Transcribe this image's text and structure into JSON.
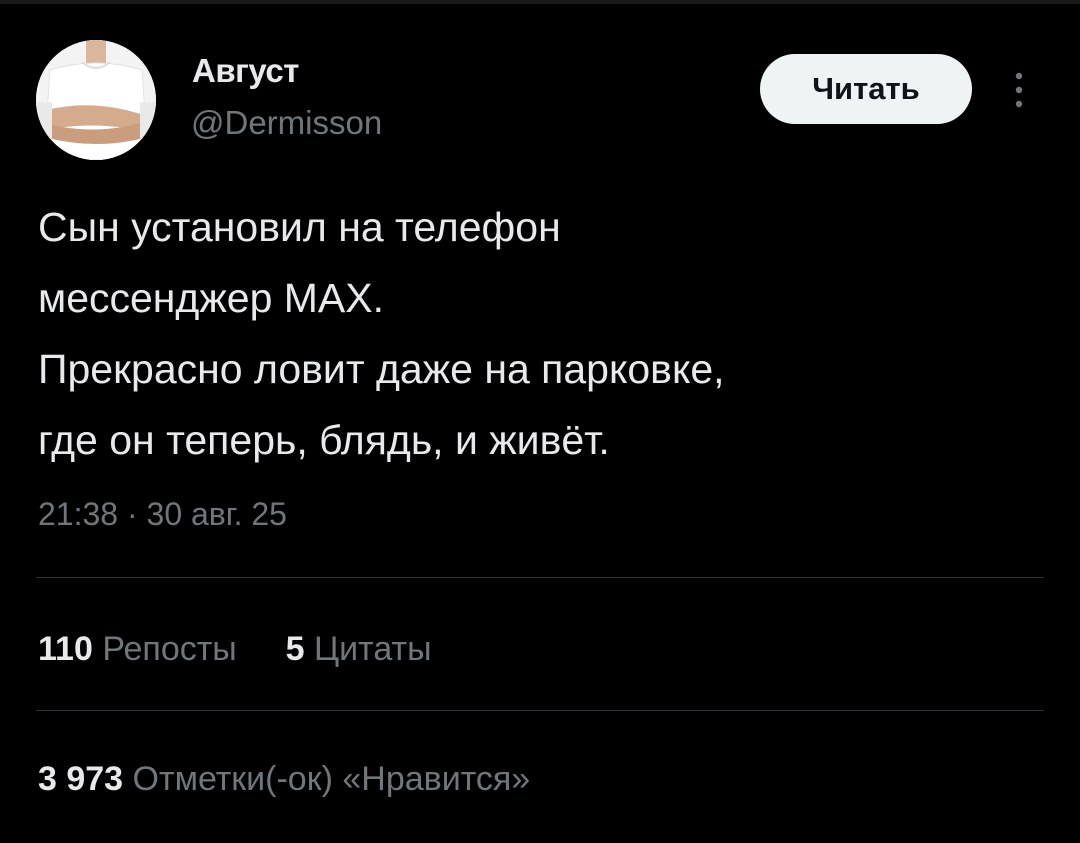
{
  "author": {
    "display_name": "Август",
    "handle": "@Dermisson"
  },
  "actions": {
    "follow_label": "Читать",
    "more_icon": "more-vertical-icon"
  },
  "tweet": {
    "lines": [
      "Сын установил на телефон",
      "мессенджер MAX.",
      "Прекрасно ловит даже на парковке,",
      "где он теперь, блядь, и живёт."
    ],
    "timestamp": "21:38 · 30 авг. 25"
  },
  "stats": {
    "reposts_count": "110",
    "reposts_label": "Репосты",
    "quotes_count": "5",
    "quotes_label": "Цитаты",
    "likes_count": "3 973",
    "likes_label": "Отметки(-ок) «Нравится»"
  },
  "colors": {
    "background": "#000000",
    "primary_text": "#e7e9ea",
    "secondary_text": "#71767b",
    "divider": "#2f3336",
    "button_bg": "#eff3f4"
  }
}
